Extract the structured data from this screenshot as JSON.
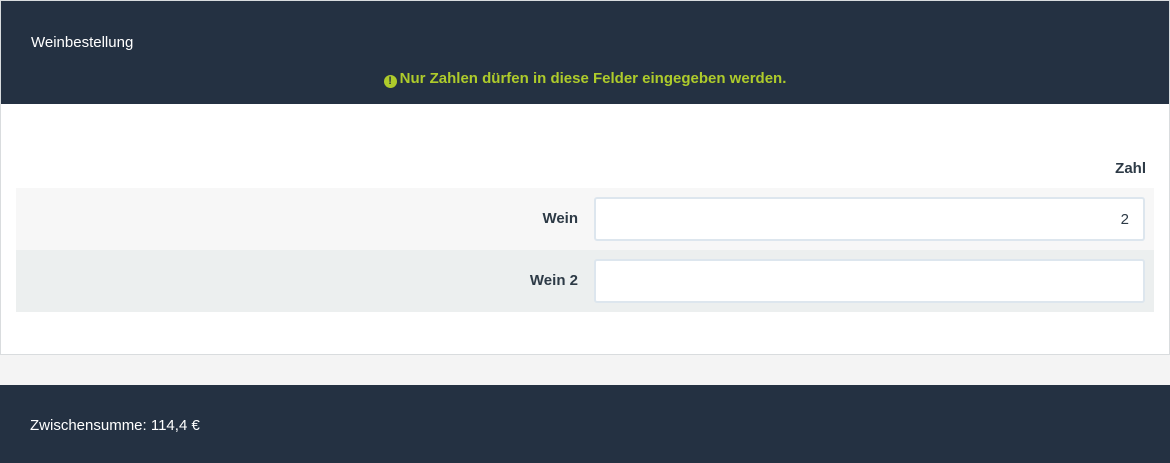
{
  "header": {
    "title": "Weinbestellung",
    "warning_icon": "exclamation-circle-icon",
    "warning_text": "Nur Zahlen dürfen in diese Felder eingegeben werden.",
    "warning_color": "#aecb2b",
    "background_color": "#243142"
  },
  "table": {
    "column_header": "Zahl",
    "rows": [
      {
        "label": "Wein",
        "value": "2"
      },
      {
        "label": "Wein 2",
        "value": ""
      }
    ]
  },
  "footer": {
    "subtotal_text": "Zwischensumme: 114,4 €"
  }
}
